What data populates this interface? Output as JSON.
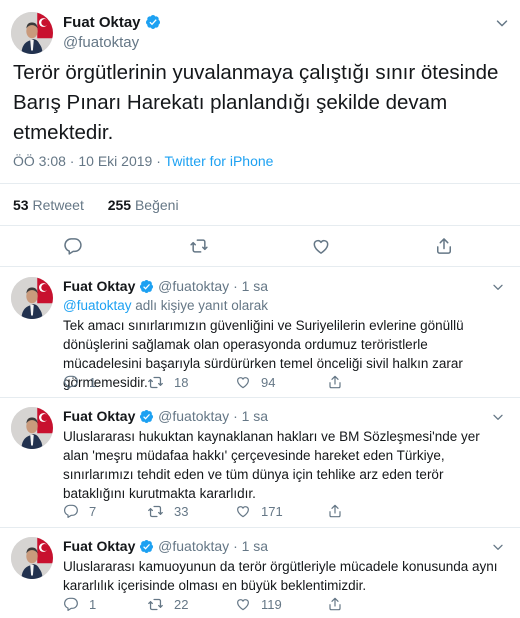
{
  "tweet": {
    "author_name": "Fuat Oktay",
    "author_handle": "@fuatoktay",
    "text": "Terör örgütlerinin yuvalanmaya çalıştığı sınır ötesinde Barış Pınarı Harekatı planlandığı şekilde devam etmektedir.",
    "time": "ÖÖ 3:08 · 10 Eki 2019 · ",
    "source": "Twitter for iPhone",
    "retweet_count": "53",
    "retweet_label": "Retweet",
    "like_count": "255",
    "like_label": "Beğeni"
  },
  "replies": [
    {
      "name": "Fuat Oktay",
      "handle": "@fuatoktay",
      "age": "· 1 sa",
      "replying_mention": "@fuatoktay",
      "replying_suffix": " adlı kişiye yanıt olarak",
      "text": "Tek amacı sınırlarımızın güvenliğini ve Suriyelilerin evlerine gönüllü dönüşlerini sağlamak olan operasyonda ordumuz teröristlerle mücadelesini başarıyla sürdürürken temel önceliği sivil halkın zarar görmemesidir.",
      "replies": "1",
      "retweets": "18",
      "likes": "94"
    },
    {
      "name": "Fuat Oktay",
      "handle": "@fuatoktay",
      "age": "· 1 sa",
      "text": "Uluslararası hukuktan kaynaklanan hakları ve BM Sözleşmesi'nde yer alan 'meşru müdafaa hakkı' çerçevesinde hareket eden Türkiye, sınırlarımızı tehdit eden ve tüm dünya için tehlike arz eden terör bataklığını kurutmakta kararlıdır.",
      "replies": "7",
      "retweets": "33",
      "likes": "171"
    },
    {
      "name": "Fuat Oktay",
      "handle": "@fuatoktay",
      "age": "· 1 sa",
      "text": "Uluslararası kamuoyunun da terör örgütleriyle mücadele konusunda aynı kararlılık içerisinde olması en büyük beklentimizdir.",
      "replies": "1",
      "retweets": "22",
      "likes": "119"
    }
  ],
  "colors": {
    "accent": "#1da1f2",
    "muted": "#657786",
    "text": "#14171a",
    "divider": "#e6ecf0"
  },
  "icons": [
    "verified-icon",
    "chevron-down-icon",
    "reply-icon",
    "retweet-icon",
    "like-icon",
    "share-icon"
  ]
}
